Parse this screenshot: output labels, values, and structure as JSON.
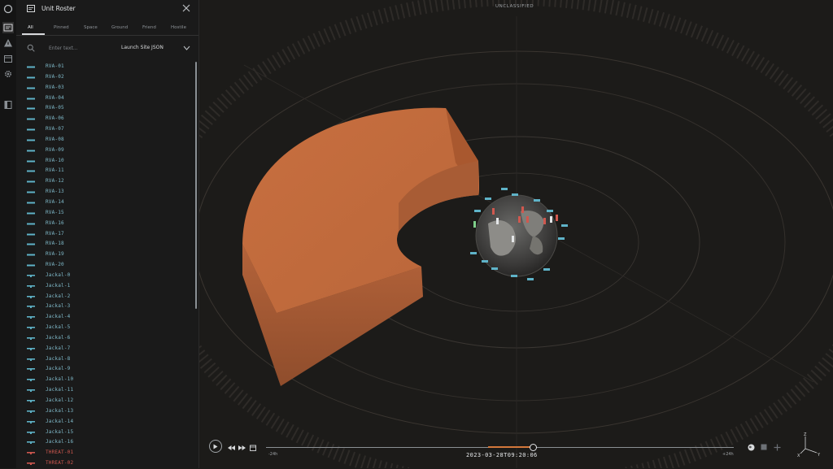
{
  "panel": {
    "title": "Unit Roster",
    "tabs": [
      "All",
      "Pinned",
      "Space",
      "Ground",
      "Friend",
      "Hostile"
    ],
    "active_tab": "All",
    "search_placeholder": "Enter text...",
    "filter_value": "Launch Site JSON"
  },
  "units": [
    {
      "name": "RVA-01",
      "type": "space"
    },
    {
      "name": "RVA-02",
      "type": "space"
    },
    {
      "name": "RVA-03",
      "type": "space"
    },
    {
      "name": "RVA-04",
      "type": "space"
    },
    {
      "name": "RVA-05",
      "type": "space"
    },
    {
      "name": "RVA-06",
      "type": "space"
    },
    {
      "name": "RVA-07",
      "type": "space"
    },
    {
      "name": "RVA-08",
      "type": "space"
    },
    {
      "name": "RVA-09",
      "type": "space"
    },
    {
      "name": "RVA-10",
      "type": "space"
    },
    {
      "name": "RVA-11",
      "type": "space"
    },
    {
      "name": "RVA-12",
      "type": "space"
    },
    {
      "name": "RVA-13",
      "type": "space"
    },
    {
      "name": "RVA-14",
      "type": "space"
    },
    {
      "name": "RVA-15",
      "type": "space"
    },
    {
      "name": "RVA-16",
      "type": "space"
    },
    {
      "name": "RVA-17",
      "type": "space"
    },
    {
      "name": "RVA-18",
      "type": "space"
    },
    {
      "name": "RVA-19",
      "type": "space"
    },
    {
      "name": "RVA-20",
      "type": "space"
    },
    {
      "name": "Jackal-0",
      "type": "ground"
    },
    {
      "name": "Jackal-1",
      "type": "ground"
    },
    {
      "name": "Jackal-2",
      "type": "ground"
    },
    {
      "name": "Jackal-3",
      "type": "ground"
    },
    {
      "name": "Jackal-4",
      "type": "ground"
    },
    {
      "name": "Jackal-5",
      "type": "ground"
    },
    {
      "name": "Jackal-6",
      "type": "ground"
    },
    {
      "name": "Jackal-7",
      "type": "ground"
    },
    {
      "name": "Jackal-8",
      "type": "ground"
    },
    {
      "name": "Jackal-9",
      "type": "ground"
    },
    {
      "name": "Jackal-10",
      "type": "ground"
    },
    {
      "name": "Jackal-11",
      "type": "ground"
    },
    {
      "name": "Jackal-12",
      "type": "ground"
    },
    {
      "name": "Jackal-13",
      "type": "ground"
    },
    {
      "name": "Jackal-14",
      "type": "ground"
    },
    {
      "name": "Jackal-15",
      "type": "ground"
    },
    {
      "name": "Jackal-16",
      "type": "ground"
    },
    {
      "name": "THREAT-01",
      "type": "threat"
    },
    {
      "name": "THREAT-02",
      "type": "threat"
    }
  ],
  "colors": {
    "space": "#5fb3c8",
    "ground": "#5fb3c8",
    "threat": "#d0584f",
    "accent": "#d4783b",
    "coverage": "#c46b3e"
  },
  "viewport": {
    "classification": "UNCLASSIFIED"
  },
  "timeline": {
    "start_label": "-24h",
    "end_label": "+24h",
    "current": "2023-03-28T09:20:06",
    "progress": 0.57
  },
  "axes": {
    "z": "Z",
    "x": "X",
    "y": "Y"
  },
  "icons": {
    "rail": [
      "app-logo-icon",
      "roster-icon",
      "alert-icon",
      "calendar-icon",
      "settings-icon",
      "panel-toggle-icon"
    ],
    "controls": [
      "play-icon",
      "skip-back-icon",
      "skip-forward-icon",
      "calendar-icon",
      "globe-icon",
      "square-icon",
      "plus-icon"
    ]
  }
}
